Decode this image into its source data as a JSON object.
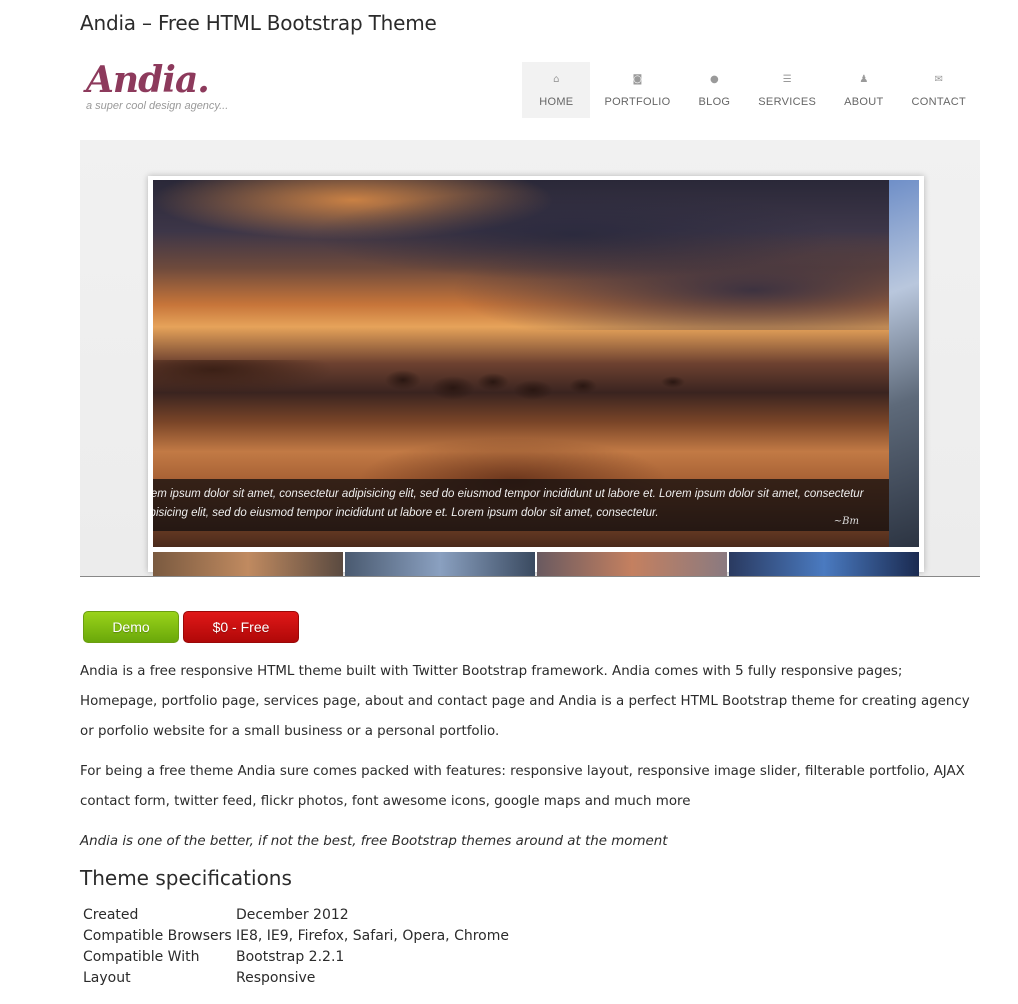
{
  "page": {
    "title": "Andia – Free HTML Bootstrap Theme"
  },
  "preview": {
    "logo": {
      "name": "Andia.",
      "tagline": "a super cool design agency..."
    },
    "nav": [
      {
        "label": "HOME",
        "icon": "home-icon",
        "glyph": "⌂",
        "active": true
      },
      {
        "label": "PORTFOLIO",
        "icon": "camera-icon",
        "glyph": "◙",
        "active": false
      },
      {
        "label": "BLOG",
        "icon": "comment-icon",
        "glyph": "●",
        "active": false
      },
      {
        "label": "SERVICES",
        "icon": "list-icon",
        "glyph": "☰",
        "active": false
      },
      {
        "label": "ABOUT",
        "icon": "user-icon",
        "glyph": "♟",
        "active": false
      },
      {
        "label": "CONTACT",
        "icon": "envelope-icon",
        "glyph": "✉",
        "active": false
      }
    ],
    "slider": {
      "caption": "rem ipsum dolor sit amet, consectetur adipisicing elit, sed do eiusmod tempor incididunt ut labore et. Lorem ipsum dolor sit amet, consectetur ipisicing elit, sed do eiusmod tempor incididunt ut labore et. Lorem ipsum dolor sit amet, consectetur."
    }
  },
  "buttons": {
    "demo": "Demo",
    "price": "$0 - Free"
  },
  "description": {
    "p1": "Andia is a free responsive HTML theme built with Twitter Bootstrap framework. Andia comes with 5 fully responsive pages; Homepage, portfolio page, services page, about and contact page and Andia is a perfect HTML Bootstrap theme for creating agency or porfolio website for a small business or a personal portfolio.",
    "p2": "For being a free theme Andia sure comes packed with features: responsive layout, responsive image slider, filterable portfolio, AJAX contact form, twitter feed, flickr photos, font awesome icons, google maps and much more",
    "p3": "Andia is one of the better, if not the best, free Bootstrap themes around at the moment"
  },
  "specs": {
    "title": "Theme specifications",
    "rows": [
      {
        "key": "Created",
        "value": "December 2012"
      },
      {
        "key": "Compatible Browsers",
        "value": "IE8, IE9, Firefox, Safari, Opera, Chrome"
      },
      {
        "key": "Compatible With",
        "value": "Bootstrap 2.2.1"
      },
      {
        "key": "Layout",
        "value": "Responsive"
      }
    ]
  },
  "colors": {
    "logo": "#8d3a5c",
    "demo_button": "#7fbf12",
    "price_button": "#c80f0f"
  }
}
